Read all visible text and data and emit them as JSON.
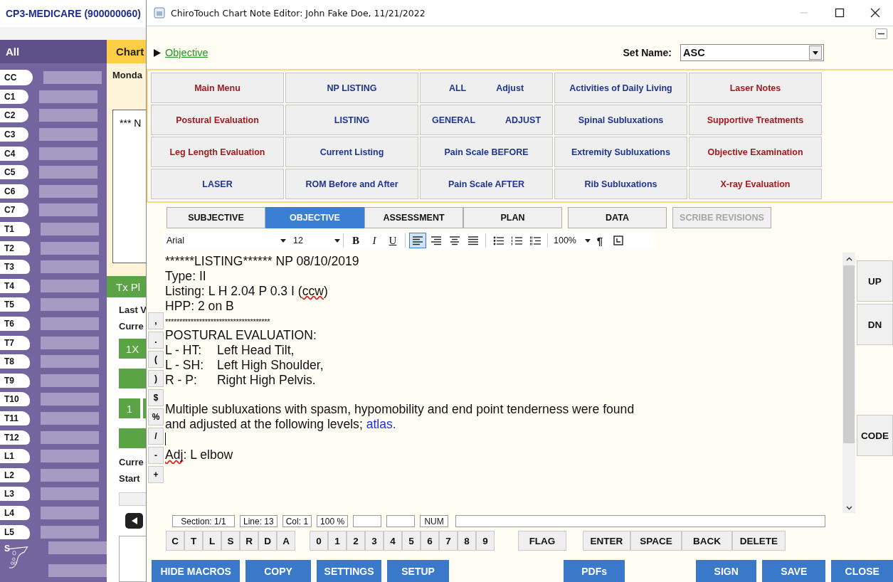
{
  "background_app": {
    "title": "CP3-MEDICARE (900000060)",
    "spine_header": "All",
    "spine_levels": [
      {
        "label": "CC",
        "kind": "skull"
      },
      {
        "label": "C1",
        "kind": "cervical"
      },
      {
        "label": "C2",
        "kind": "cervical"
      },
      {
        "label": "C3",
        "kind": "cervical"
      },
      {
        "label": "C4",
        "kind": "cervical"
      },
      {
        "label": "C5",
        "kind": "cervical"
      },
      {
        "label": "C6",
        "kind": "cervical"
      },
      {
        "label": "C7",
        "kind": "cervical"
      },
      {
        "label": "T1",
        "kind": "thoracic"
      },
      {
        "label": "T2",
        "kind": "thoracic"
      },
      {
        "label": "T3",
        "kind": "thoracic"
      },
      {
        "label": "T4",
        "kind": "thoracic"
      },
      {
        "label": "T5",
        "kind": "thoracic"
      },
      {
        "label": "T6",
        "kind": "thoracic"
      },
      {
        "label": "T7",
        "kind": "thoracic"
      },
      {
        "label": "T8",
        "kind": "thoracic"
      },
      {
        "label": "T9",
        "kind": "thoracic"
      },
      {
        "label": "T10",
        "kind": "thoracic"
      },
      {
        "label": "T11",
        "kind": "thoracic"
      },
      {
        "label": "T12",
        "kind": "thoracic"
      },
      {
        "label": "L1",
        "kind": "lumbar"
      },
      {
        "label": "L2",
        "kind": "lumbar"
      },
      {
        "label": "L3",
        "kind": "lumbar"
      },
      {
        "label": "L4",
        "kind": "lumbar"
      },
      {
        "label": "L5",
        "kind": "lumbar"
      },
      {
        "label": "S",
        "kind": "sacrum"
      }
    ],
    "chart_tab": "Chart",
    "day": "Monda",
    "note_preview": "*** N",
    "tx_plan": {
      "header": "Tx Pl",
      "rows": [
        {
          "kind": "label",
          "text": "Last V"
        },
        {
          "kind": "label",
          "text": "Curre"
        },
        {
          "kind": "button",
          "text": "1X"
        },
        {
          "kind": "button"
        },
        {
          "kind": "button-pair",
          "text": "1"
        },
        {
          "kind": "button"
        },
        {
          "kind": "label",
          "text": "Curre"
        },
        {
          "kind": "label",
          "text": "Start"
        },
        {
          "kind": "field"
        },
        {
          "kind": "back-button"
        },
        {
          "kind": "box"
        }
      ]
    }
  },
  "window": {
    "title": "ChiroTouch Chart Note Editor: John Fake Doe, 11/21/2022"
  },
  "section_link": "Objective",
  "set_name": {
    "label": "Set Name:",
    "value": "ASC"
  },
  "macro_buttons": [
    {
      "label": "Main Menu",
      "color": "#a31b1f"
    },
    {
      "label": "NP LISTING",
      "color": "#1f3590"
    },
    {
      "label": "ALL",
      "label_2": "Adjust",
      "color": "#1f3590"
    },
    {
      "label": "Activities of Daily Living",
      "color": "#1f3590"
    },
    {
      "label": "Laser Notes",
      "color": "#a31b1f"
    },
    {
      "label": "Postural Evaluation",
      "color": "#a31b1f"
    },
    {
      "label": "LISTING",
      "color": "#1f3590"
    },
    {
      "label": "GENERAL",
      "label_2": "ADJUST",
      "color": "#1f3590"
    },
    {
      "label": "Spinal Subluxations",
      "color": "#1f3590"
    },
    {
      "label": "Supportive Treatments",
      "color": "#a31b1f"
    },
    {
      "label": "Leg Length Evaluation",
      "color": "#a31b1f"
    },
    {
      "label": "Current Listing",
      "color": "#1f3590"
    },
    {
      "label": "Pain Scale BEFORE",
      "color": "#1f3590"
    },
    {
      "label": "Extremity Subluxations",
      "color": "#1f3590"
    },
    {
      "label": "Objective Examination",
      "color": "#a31b1f"
    },
    {
      "label": "LASER",
      "color": "#1f3590"
    },
    {
      "label": "ROM Before and After",
      "color": "#1f3590"
    },
    {
      "label": "Pain Scale AFTER",
      "color": "#1f3590"
    },
    {
      "label": "Rib Subluxations",
      "color": "#1f3590"
    },
    {
      "label": "X-ray Evaluation",
      "color": "#a31b1f"
    }
  ],
  "tabs": [
    {
      "label": "SUBJECTIVE",
      "selected": false,
      "disabled": false
    },
    {
      "label": "OBJECTIVE",
      "selected": true,
      "disabled": false
    },
    {
      "label": "ASSESSMENT",
      "selected": false,
      "disabled": false
    },
    {
      "label": "PLAN",
      "selected": false,
      "disabled": false
    },
    {
      "label": "DATA",
      "selected": false,
      "disabled": false
    },
    {
      "label": "SCRIBE REVISIONS",
      "selected": false,
      "disabled": true
    }
  ],
  "toolbar": {
    "font": "Arial",
    "size": "12",
    "format_buttons": [
      {
        "label": "B",
        "kind": "bold"
      },
      {
        "label": "I",
        "kind": "italic"
      },
      {
        "label": "U",
        "kind": "underline"
      }
    ],
    "alignment": [
      {
        "kind": "left",
        "selected": true
      },
      {
        "kind": "right",
        "selected": false
      },
      {
        "kind": "center",
        "selected": false
      },
      {
        "kind": "justify",
        "selected": false
      }
    ],
    "lists": [
      {
        "kind": "bullets"
      },
      {
        "kind": "numbers"
      },
      {
        "kind": "multilevel"
      }
    ],
    "zoom": "100%",
    "pilcrow": "¶"
  },
  "punctuation_keys": [
    ",",
    ".",
    "(",
    ")",
    "$",
    "%",
    "/",
    "-",
    "+"
  ],
  "editor_lines": [
    {
      "kind": "text",
      "segments": [
        {
          "kind": "plain",
          "text": "******LISTING****** NP 08/10/2019"
        }
      ]
    },
    {
      "kind": "text",
      "segments": [
        {
          "kind": "plain",
          "text": "Type: II"
        }
      ]
    },
    {
      "kind": "text",
      "segments": [
        {
          "kind": "plain",
          "text": "Listing: L H 2.04 P 0.3 I ("
        },
        {
          "kind": "misspelled",
          "text": "ccw"
        },
        {
          "kind": "plain",
          "text": ")"
        }
      ]
    },
    {
      "kind": "text",
      "segments": [
        {
          "kind": "plain",
          "text": "HPP: 2 on B"
        }
      ]
    },
    {
      "kind": "rule",
      "text": "*************************************"
    },
    {
      "kind": "text",
      "segments": [
        {
          "kind": "plain",
          "text": "POSTURAL EVALUATION:"
        }
      ]
    },
    {
      "kind": "pair",
      "code": "L - HT:",
      "meaning": "Left Head Tilt,"
    },
    {
      "kind": "pair",
      "code": "L - SH:",
      "meaning": "Left High Shoulder,"
    },
    {
      "kind": "pair",
      "code": "R - P:",
      "meaning": "Right High Pelvis."
    },
    {
      "kind": "blank"
    },
    {
      "kind": "text",
      "segments": [
        {
          "kind": "plain",
          "text": "Multiple subluxations with spasm, hypomobility and end point tenderness were found"
        }
      ]
    },
    {
      "kind": "text",
      "segments": [
        {
          "kind": "plain",
          "text": "and adjusted at the following levels;  "
        },
        {
          "kind": "field",
          "text": "atlas."
        }
      ]
    },
    {
      "kind": "caret"
    },
    {
      "kind": "text",
      "segments": [
        {
          "kind": "misspelled",
          "text": "Adj"
        },
        {
          "kind": "plain",
          "text": ": L elbow"
        }
      ]
    }
  ],
  "side_buttons": [
    {
      "label": "UP"
    },
    {
      "label": "DN"
    },
    {
      "label": "CODE"
    }
  ],
  "status_fields": [
    {
      "kind": "label",
      "text": "Section: 1/1"
    },
    {
      "kind": "label",
      "text": "Line: 13"
    },
    {
      "kind": "label",
      "text": "Col: 1"
    },
    {
      "kind": "label",
      "text": "100 %"
    },
    {
      "kind": "empty"
    },
    {
      "kind": "empty"
    },
    {
      "kind": "label",
      "text": "NUM"
    },
    {
      "kind": "wide"
    }
  ],
  "keypad": {
    "letters": [
      "C",
      "T",
      "L",
      "S",
      "R",
      "D",
      "A"
    ],
    "digits": [
      "0",
      "1",
      "2",
      "3",
      "4",
      "5",
      "6",
      "7",
      "8",
      "9"
    ],
    "flag": "FLAG",
    "edit_keys": [
      "ENTER",
      "SPACE",
      "BACK",
      "DELETE"
    ]
  },
  "bottom_buttons": {
    "left": [
      "HIDE MACROS",
      "COPY",
      "SETTINGS",
      "SETUP"
    ],
    "middle": [
      "PDFs"
    ],
    "right": [
      "SIGN",
      "SAVE",
      "CLOSE"
    ]
  }
}
